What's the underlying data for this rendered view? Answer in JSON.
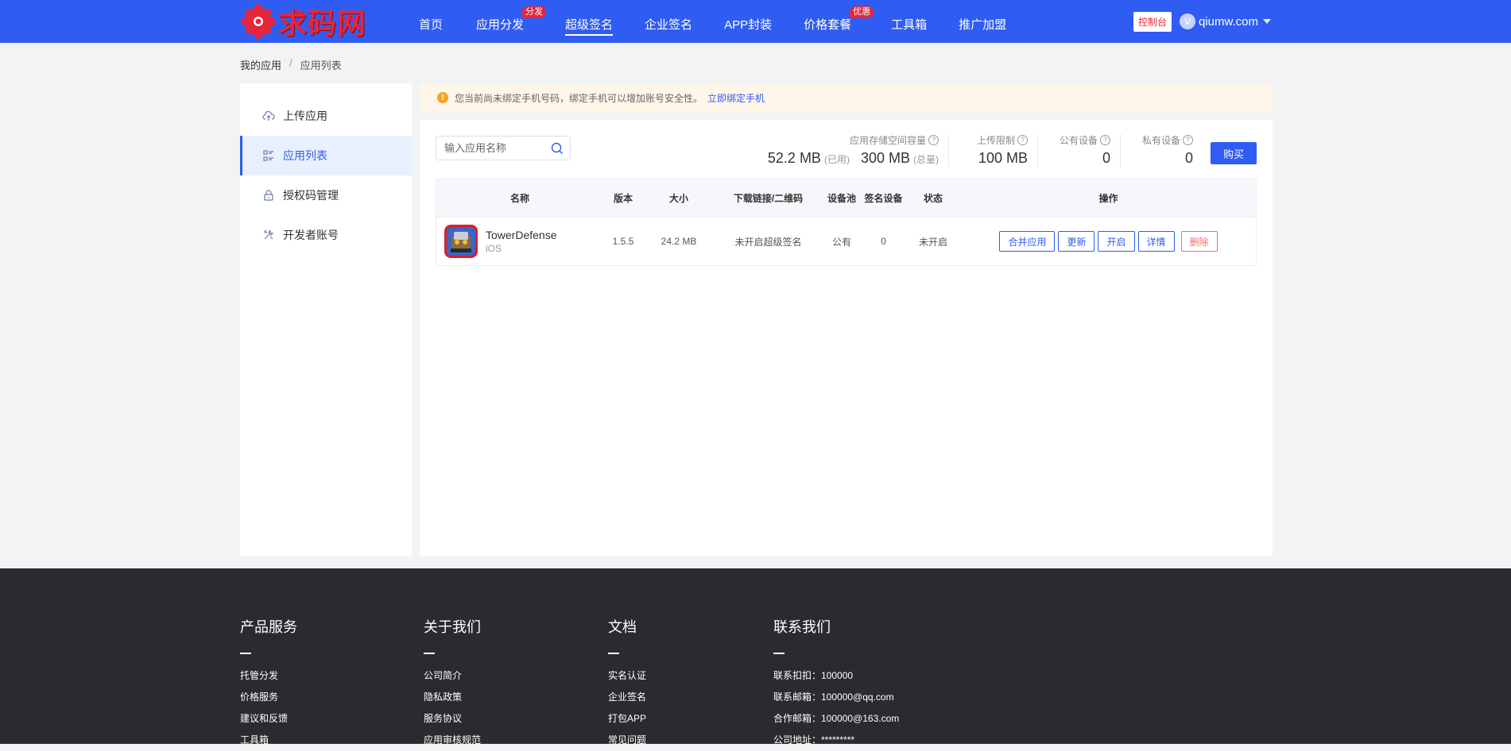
{
  "header": {
    "logo_text": "求码网",
    "nav": [
      {
        "label": "首页",
        "badge": null
      },
      {
        "label": "应用分发",
        "badge": "分发"
      },
      {
        "label": "超级签名",
        "badge": null
      },
      {
        "label": "企业签名",
        "badge": null
      },
      {
        "label": "APP封装",
        "badge": null
      },
      {
        "label": "价格套餐",
        "badge": "优惠"
      },
      {
        "label": "工具箱",
        "badge": null
      },
      {
        "label": "推广加盟",
        "badge": null
      }
    ],
    "console_label": "控制台",
    "avatar_letter": "V",
    "username": "qiumw.com"
  },
  "breadcrumb": {
    "root": "我的应用",
    "sep": "/",
    "current": "应用列表"
  },
  "sidebar": {
    "items": [
      {
        "label": "上传应用",
        "icon": "cloud-upload-icon"
      },
      {
        "label": "应用列表",
        "icon": "list-icon"
      },
      {
        "label": "授权码管理",
        "icon": "lock-icon"
      },
      {
        "label": "开发者账号",
        "icon": "tools-icon"
      }
    ]
  },
  "alert": {
    "icon": "!",
    "text": "您当前尚未绑定手机号码，绑定手机可以增加账号安全性。",
    "link": "立即绑定手机"
  },
  "search": {
    "placeholder": "输入应用名称"
  },
  "stats": {
    "storage_label": "应用存储空间容量",
    "used_value": "52.2 MB",
    "used_suffix": "(已用)",
    "total_value": "300 MB",
    "total_suffix": "(总量)",
    "upload_label": "上传限制",
    "upload_value": "100 MB",
    "public_label": "公有设备",
    "public_value": "0",
    "private_label": "私有设备",
    "private_value": "0",
    "buy_label": "购买",
    "help": "?"
  },
  "table": {
    "headers": [
      "名称",
      "版本",
      "大小",
      "下载链接/二维码",
      "设备池",
      "签名设备",
      "状态",
      "操作"
    ],
    "rows": [
      {
        "name": "TowerDefense",
        "os": "iOS",
        "version": "1.5.5",
        "size": "24.2 MB",
        "link": "未开启超级签名",
        "pool": "公有",
        "signed": "0",
        "status": "未开启",
        "ops": [
          "合并应用",
          "更新",
          "开启",
          "详情"
        ],
        "danger_op": "删除"
      }
    ]
  },
  "footer": {
    "columns": [
      {
        "title": "产品服务",
        "links": [
          "托管分发",
          "价格服务",
          "建议和反馈",
          "工具箱"
        ]
      },
      {
        "title": "关于我们",
        "links": [
          "公司简介",
          "隐私政策",
          "服务协议",
          "应用审核规范"
        ]
      },
      {
        "title": "文档",
        "links": [
          "实名认证",
          "企业签名",
          "打包APP",
          "常见问题"
        ]
      },
      {
        "title": "联系我们",
        "links": [
          "联系扣扣：100000",
          "联系邮箱：100000@qq.com",
          "合作邮箱：100000@163.com",
          "公司地址：*********"
        ]
      }
    ]
  },
  "colors": {
    "primary": "#2f5cf2",
    "danger": "#f56c6c",
    "brand_red": "#e8253a",
    "footer_bg": "#2a2b2e"
  }
}
